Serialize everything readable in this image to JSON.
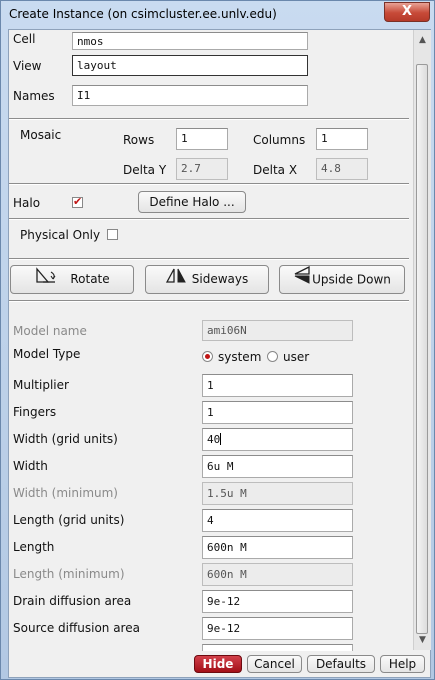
{
  "window": {
    "title": "Create Instance (on csimcluster.ee.unlv.edu)",
    "close_glyph": "X"
  },
  "basic": {
    "cell_label": "Cell",
    "cell_value": "nmos",
    "view_label": "View",
    "view_value": "layout",
    "names_label": "Names",
    "names_value": "I1"
  },
  "mosaic": {
    "label": "Mosaic",
    "rows_label": "Rows",
    "rows_value": "1",
    "columns_label": "Columns",
    "columns_value": "1",
    "delta_y_label": "Delta Y",
    "delta_y_value": "2.7",
    "delta_x_label": "Delta X",
    "delta_x_value": "4.8"
  },
  "halo": {
    "label": "Halo",
    "checked": true,
    "define_button": "Define Halo ..."
  },
  "physical_only": {
    "label": "Physical Only",
    "checked": false
  },
  "transform": {
    "rotate": "Rotate",
    "sideways": "Sideways",
    "upside_down": "Upside Down"
  },
  "params": {
    "model_name_label": "Model name",
    "model_name_value": "ami06N",
    "model_type_label": "Model Type",
    "model_type_options": [
      "system",
      "user"
    ],
    "model_type_selected": "system",
    "multiplier_label": "Multiplier",
    "multiplier_value": "1",
    "fingers_label": "Fingers",
    "fingers_value": "1",
    "width_grid_label": "Width (grid units)",
    "width_grid_value": "40",
    "width_label": "Width",
    "width_value": "6u M",
    "width_min_label": "Width (minimum)",
    "width_min_value": "1.5u M",
    "length_grid_label": "Length (grid units)",
    "length_grid_value": "4",
    "length_label": "Length",
    "length_value": "600n M",
    "length_min_label": "Length (minimum)",
    "length_min_value": "600n M",
    "drain_label": "Drain diffusion area",
    "drain_value": "9e-12",
    "source_label": "Source diffusion area",
    "source_value": "9e-12"
  },
  "footer": {
    "hide": "Hide",
    "cancel": "Cancel",
    "defaults": "Defaults",
    "help": "Help"
  },
  "colors": {
    "accent_red": "#c01616",
    "hide_button": "#b3121b",
    "title_bar": "#b9cde6"
  }
}
